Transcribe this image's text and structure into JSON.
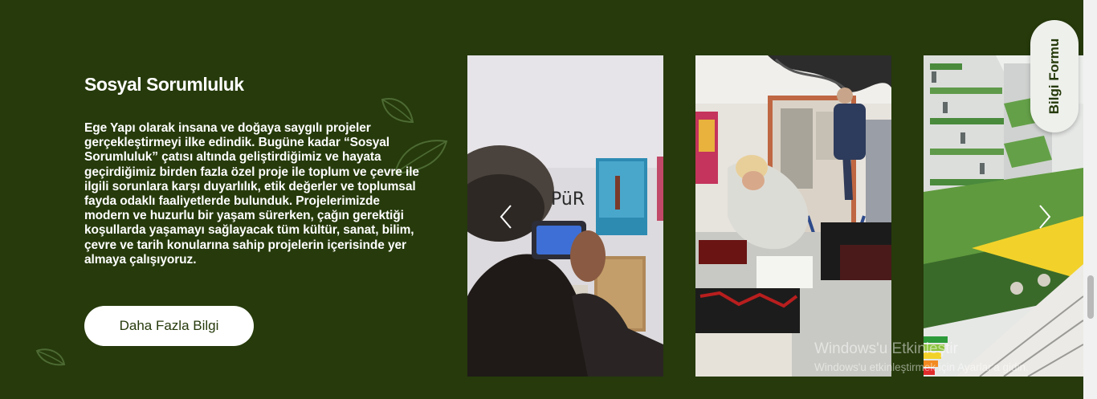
{
  "section": {
    "title": "Sosyal Sorumluluk",
    "description": "Ege Yapı olarak insana ve doğaya saygılı projeler gerçekleştirmeyi ilke edindik. Bugüne kadar “Sosyal Sorumluluk” çatısı altında geliştirdiğimiz ve hayata geçirdiğimiz birden fazla özel proje ile toplum ve çevre ile ilgili sorunlara karşı duyarlılık, etik değerler ve toplumsal fayda odaklı faaliyetlerde bulunduk. Projelerimizde modern ve huzurlu bir yaşam sürerken, çağın gerektiği koşullarda yaşamayı sağlayacak tüm kültür, sanat, bilim, çevre ve tarih konularına sahip projelerin içerisinde yer almaya çalışıyoruz.",
    "button_label": "Daha Fazla Bilgi"
  },
  "gallery": {
    "slide1_sign": "PüR",
    "prev_icon": "chevron-left-icon",
    "next_icon": "chevron-right-icon"
  },
  "info_tab": {
    "label": "Bilgi Formu"
  },
  "watermark": {
    "line1": "Windows'u Etkinleştir",
    "line2": "Windows'u etkinleştirmek için Ayarlar'a gidin."
  },
  "colors": {
    "background": "#263a0b",
    "button_bg": "#ffffff",
    "button_text": "#263a0b",
    "tab_bg": "#eef0ec"
  }
}
